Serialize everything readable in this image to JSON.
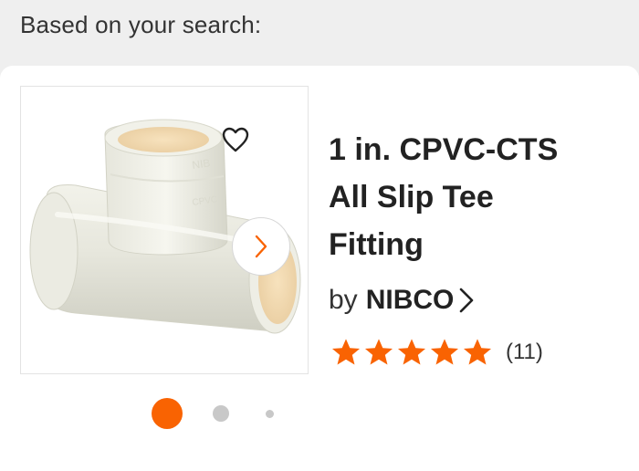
{
  "header": {
    "text": "Based on your search:"
  },
  "product": {
    "title_lines": [
      "1 in. CPVC-CTS",
      "All Slip Tee",
      "Fitting"
    ],
    "brand_prefix": "by",
    "brand": "NIBCO",
    "rating": 5,
    "rating_max": 5,
    "review_count": "(11)",
    "image_icon": "pipe-tee-fitting"
  },
  "carousel": {
    "current_index": 1,
    "total": 3
  },
  "colors": {
    "accent": "#f96302",
    "dot_inactive": "#c8c8c8",
    "text": "#222222"
  },
  "icons": {
    "favorite": "heart-outline-icon",
    "next": "chevron-right-icon",
    "brand_link": "chevron-right-icon",
    "star": "star-icon"
  }
}
